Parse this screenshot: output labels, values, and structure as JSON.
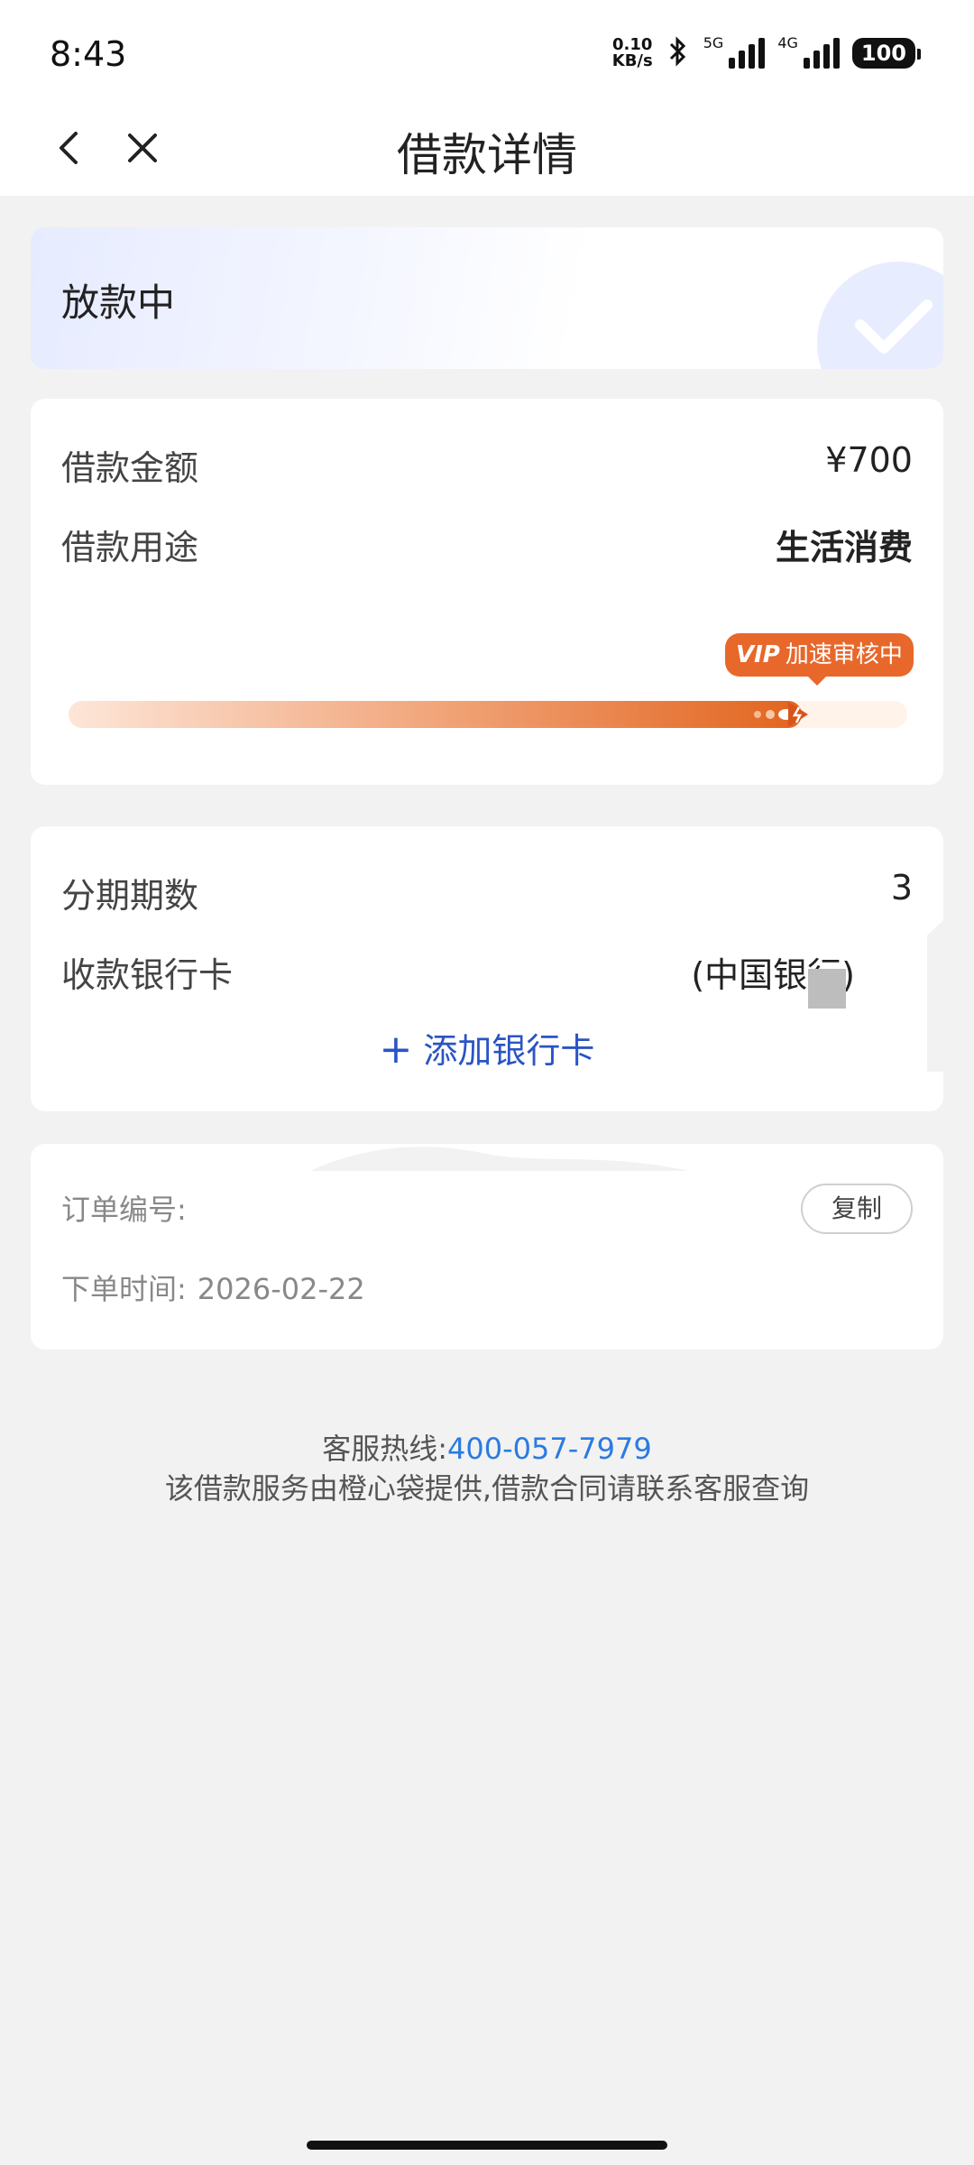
{
  "status_bar": {
    "time": "8:43",
    "net_speed_value": "0.10",
    "net_speed_unit": "KB/s",
    "signal_1_label": "5G",
    "signal_2_label": "4G",
    "battery": "100"
  },
  "nav": {
    "title": "借款详情",
    "back_icon": "chevron-left-icon",
    "close_icon": "close-icon"
  },
  "status_card": {
    "title": "放款中",
    "icon": "check-icon"
  },
  "loan_info": {
    "amount_label": "借款金额",
    "amount_value": "¥700",
    "purpose_label": "借款用途",
    "purpose_value": "生活消费",
    "progress_tag_vip": "VIP",
    "progress_tag_text": "加速审核中",
    "progress_fraction": 0.93
  },
  "installment_info": {
    "periods_label": "分期期数",
    "periods_value": "3",
    "bank_label": "收款银行卡",
    "bank_value": "(中国银行)",
    "add_card_label": "添加银行卡"
  },
  "order_info": {
    "order_no_label": "订单编号:",
    "copy_label": "复制",
    "order_time_label": "下单时间:",
    "order_time_value": "2026-02-22"
  },
  "footer": {
    "hotline_label": "客服热线:",
    "hotline_number": "400-057-7979",
    "note": "该借款服务由橙心袋提供,借款合同请联系客服查询"
  },
  "colors": {
    "accent_blue": "#2a54c6",
    "hotline_blue": "#2a7be0",
    "progress_orange": "#e2641e"
  }
}
